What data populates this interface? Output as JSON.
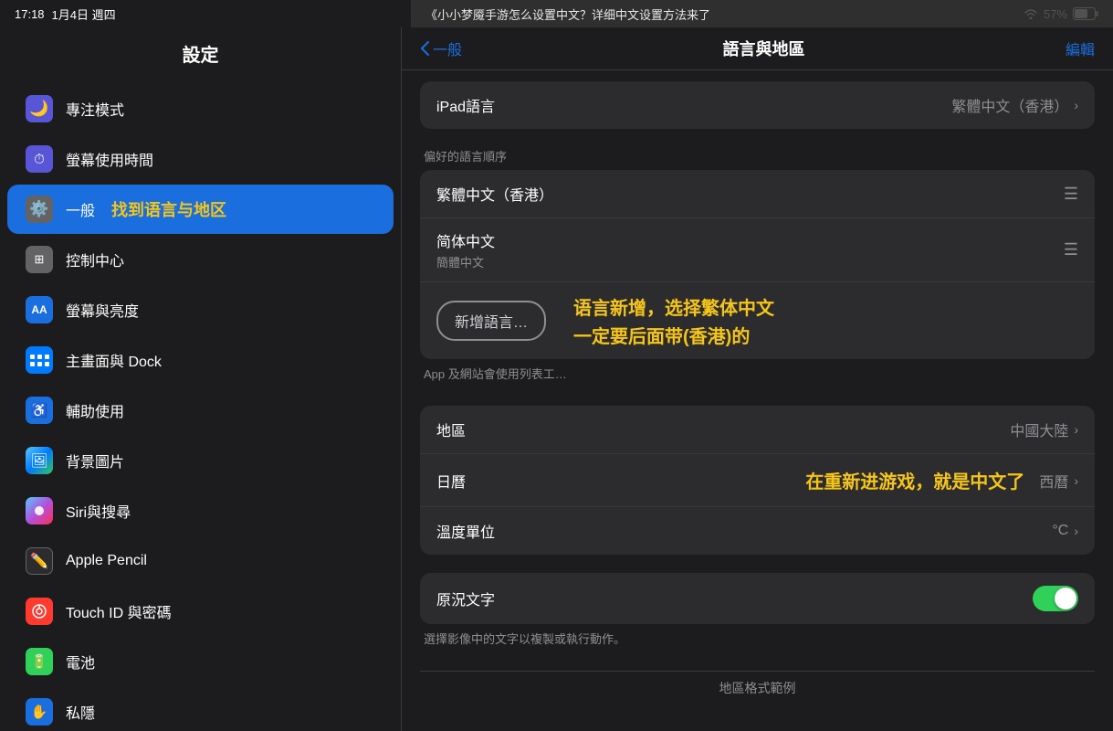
{
  "statusBar": {
    "time": "17:18",
    "date": "1月4日 週四",
    "wifi": "57%",
    "battery": "57%"
  },
  "overlayTitle": "《小小梦魇手游怎么设置中文？详细中文设置方法来了",
  "sidebar": {
    "header": "設定",
    "items": [
      {
        "id": "focus",
        "icon": "🌙",
        "label": "專注模式",
        "iconBg": "icon-purple",
        "active": false
      },
      {
        "id": "screen-time",
        "icon": "⏱",
        "label": "螢幕使用時間",
        "iconBg": "icon-purple",
        "active": false
      },
      {
        "id": "general",
        "icon": "⚙️",
        "label": "一般",
        "iconBg": "icon-gray",
        "active": true,
        "annotation": "找到语言与地区"
      },
      {
        "id": "control-center",
        "icon": "⊞",
        "label": "控制中心",
        "iconBg": "icon-gray",
        "active": false
      },
      {
        "id": "display",
        "icon": "AA",
        "label": "螢幕與亮度",
        "iconBg": "icon-blue",
        "active": false
      },
      {
        "id": "home-dock",
        "icon": "⋮⋮⋮",
        "label": "主畫面與 Dock",
        "iconBg": "icon-indigo",
        "active": false
      },
      {
        "id": "accessibility",
        "icon": "♿",
        "label": "輔助使用",
        "iconBg": "icon-blue",
        "active": false
      },
      {
        "id": "wallpaper",
        "icon": "🖼",
        "label": "背景圖片",
        "iconBg": "icon-teal",
        "active": false
      },
      {
        "id": "siri",
        "icon": "◯",
        "label": "Siri與搜尋",
        "iconBg": "icon-siri",
        "active": false
      },
      {
        "id": "apple-pencil",
        "icon": "✏",
        "label": "Apple Pencil",
        "iconBg": "icon-pencil",
        "active": false
      },
      {
        "id": "touchid",
        "icon": "⊙",
        "label": "Touch ID 與密碼",
        "iconBg": "icon-red",
        "active": false
      },
      {
        "id": "battery",
        "icon": "🔋",
        "label": "電池",
        "iconBg": "icon-green",
        "active": false
      },
      {
        "id": "privacy",
        "icon": "✋",
        "label": "私隱",
        "iconBg": "icon-blue",
        "active": false
      }
    ]
  },
  "contentPanel": {
    "navBack": "一般",
    "navTitle": "語言與地區",
    "navEdit": "編輯",
    "sections": {
      "ipadLanguage": {
        "label": "iPad語言",
        "value": "繁體中文（香港）"
      },
      "preferredLanguages": {
        "sectionLabel": "偏好的語言順序",
        "languages": [
          {
            "name": "繁體中文（香港）",
            "hasHandle": true
          },
          {
            "name": "简体中文",
            "subname": "簡體中文",
            "hasHandle": true
          }
        ],
        "addButton": "新增語言…",
        "footerText": "App 及網站會使用列表工…"
      },
      "region": {
        "label": "地區",
        "value": "中國大陸"
      },
      "calendar": {
        "label": "日曆",
        "value": "西曆"
      },
      "temperature": {
        "label": "溫度單位",
        "value": "°C"
      },
      "liveText": {
        "label": "原況文字",
        "toggleOn": true,
        "footerText": "選擇影像中的文字以複製或執行動作。"
      },
      "regionFormat": {
        "label": "地區格式範例"
      }
    },
    "annotations": {
      "addLanguage": "语言新增，选择繁体中文",
      "addLanguage2": "一定要后面带(香港)的",
      "reenter": "在重新进游戏，就是中文了"
    }
  }
}
